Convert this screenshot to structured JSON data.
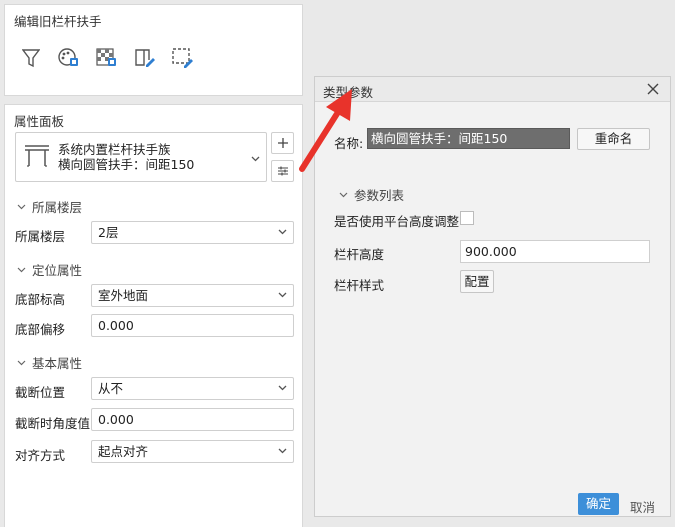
{
  "edit_panel": {
    "title": "编辑旧栏杆扶手",
    "tools": [
      "filter-icon",
      "palette-icon",
      "texture-icon",
      "edit-book-icon",
      "select-edit-icon"
    ]
  },
  "properties": {
    "title": "属性面板",
    "family_line1": "系统内置栏杆扶手族",
    "family_line2": "横向圆管扶手：间距150",
    "sections": {
      "floor": "所属楼层",
      "position": "定位属性",
      "basic": "基本属性"
    },
    "rows": {
      "floor_label": "所属楼层",
      "floor_value": "2层",
      "base_elev_label": "底部标高",
      "base_elev_value": "室外地面",
      "base_offset_label": "底部偏移",
      "base_offset_value": "0.000",
      "cut_pos_label": "截断位置",
      "cut_pos_value": "从不",
      "cut_angle_label": "截断时角度值",
      "cut_angle_value": "0.000",
      "align_label": "对齐方式",
      "align_value": "起点对齐"
    }
  },
  "dialog": {
    "title": "类型参数",
    "name_label": "名称:",
    "name_value": "横向圆管扶手：间距150",
    "rename_label": "重命名",
    "param_section": "参数列表",
    "platform_label": "是否使用平台高度调整",
    "height_label": "栏杆高度",
    "height_value": "900.000",
    "style_label": "栏杆样式",
    "config_label": "配置",
    "ok_label": "确定",
    "cancel_label": "取消"
  },
  "colors": {
    "accent": "#3d8fd9",
    "arrow": "#e8332b",
    "icon_blue": "#2f7fd1"
  }
}
